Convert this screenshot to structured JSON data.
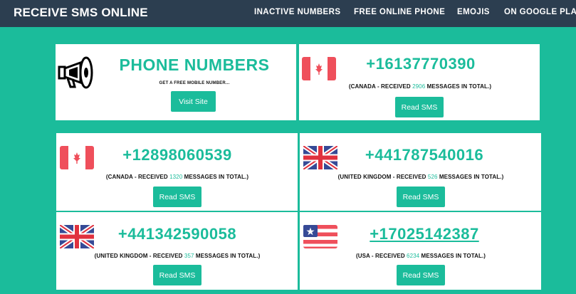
{
  "nav": {
    "brand": "RECEIVE SMS ONLINE",
    "links": [
      "INACTIVE NUMBERS",
      "FREE ONLINE PHONE",
      "EMOJIS",
      "ON GOOGLE PLAY"
    ]
  },
  "promo": {
    "icon": "megaphone-icon",
    "title": "PHONE NUMBERS",
    "subtitle": "GET A FREE MOBILE NUMBER...",
    "button_label": "Visit Site"
  },
  "phone_cards": [
    {
      "number": "+16137770390",
      "prefix": "(CANADA - RECEIVED ",
      "count": "2906",
      "suffix": " MESSAGES IN TOTAL.)",
      "button_label": "Read SMS",
      "flag": "canada-flag-icon"
    },
    {
      "number": "+12898060539",
      "prefix": "(CANADA - RECEIVED ",
      "count": "1320",
      "suffix": " MESSAGES IN TOTAL.)",
      "button_label": "Read SMS",
      "flag": "canada-flag-icon"
    },
    {
      "number": "+441787540016",
      "prefix": "(UNITED KINGDOM - RECEIVED ",
      "count": "526",
      "suffix": " MESSAGES IN TOTAL.)",
      "button_label": "Read SMS",
      "flag": "uk-flag-icon"
    },
    {
      "number": "+441342590058",
      "prefix": "(UNITED KINGDOM - RECEIVED ",
      "count": "357",
      "suffix": " MESSAGES IN TOTAL.)",
      "button_label": "Read SMS",
      "flag": "uk-flag-icon"
    },
    {
      "number": "+17025142387",
      "prefix": "(USA - RECEIVED ",
      "count": "6234",
      "suffix": " MESSAGES IN TOTAL.)",
      "button_label": "Read SMS",
      "flag": "usa-flag-icon"
    }
  ],
  "colors": {
    "accent": "#1bbc9b",
    "navbar": "#2c3e50",
    "canada_red": "#ef4f5b",
    "uk_blue": "#364a96",
    "uk_red": "#e0313e"
  }
}
